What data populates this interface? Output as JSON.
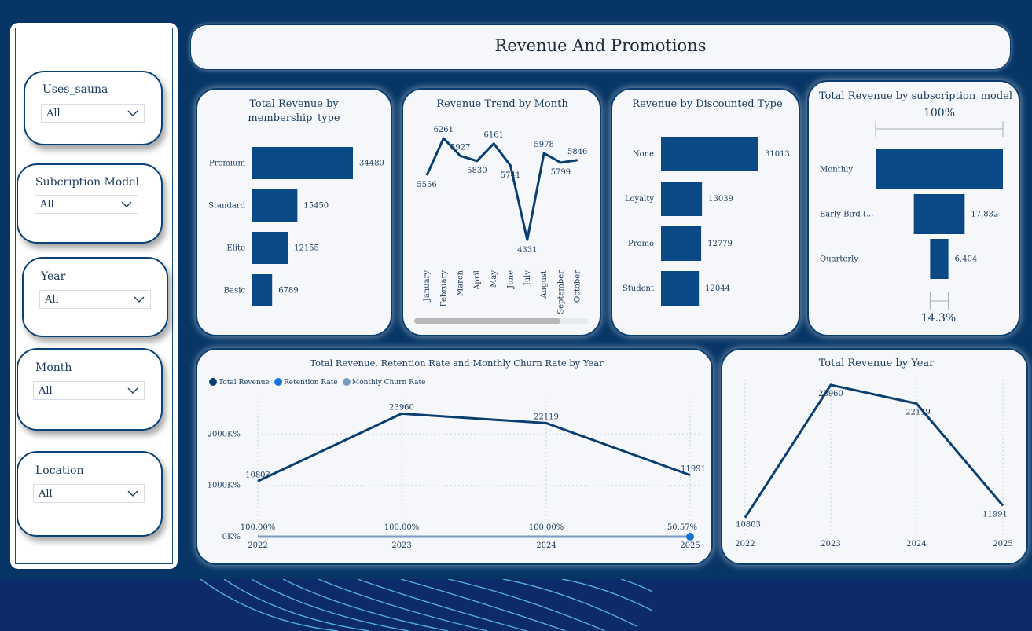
{
  "page": {
    "title": "Revenue And Promotions",
    "colors": {
      "background": "#063566",
      "bar": "#0b4886",
      "line": "#0b3e70",
      "accent": "#1573d6",
      "churn": "#7b9cc0"
    }
  },
  "filters": [
    {
      "title": "Uses_sauna",
      "value": "All"
    },
    {
      "title": "Subcription Model",
      "value": "All"
    },
    {
      "title": "Year",
      "value": "All"
    },
    {
      "title": "Month",
      "value": "All"
    },
    {
      "title": "Location",
      "value": "All"
    }
  ],
  "chart_data": [
    {
      "type": "bar",
      "orientation": "horizontal",
      "title": "Total Revenue by membership_type",
      "title_lines": [
        "Total Revenue by",
        "membership_type"
      ],
      "categories": [
        "Premium",
        "Standard",
        "Elite",
        "Basic"
      ],
      "values": [
        34480,
        15450,
        12155,
        6789
      ],
      "data_labels": [
        "34480",
        "15450",
        "12155",
        "6789"
      ]
    },
    {
      "type": "line",
      "title": "Revenue Trend by Month",
      "categories": [
        "January",
        "February",
        "March",
        "April",
        "May",
        "June",
        "July",
        "August",
        "September",
        "October"
      ],
      "values": [
        5556,
        6261,
        5927,
        5830,
        6161,
        5741,
        4331,
        5978,
        5799,
        5846
      ],
      "data_labels": [
        "5556",
        "6261",
        "5927",
        "5830",
        "6161",
        "5741",
        "4331",
        "5978",
        "5799",
        "5846"
      ],
      "ylim": [
        4200,
        6350
      ]
    },
    {
      "type": "bar",
      "orientation": "horizontal",
      "title": "Revenue by Discounted Type",
      "categories": [
        "None",
        "Loyalty",
        "Promo",
        "Student"
      ],
      "values": [
        31013,
        13039,
        12779,
        12044
      ],
      "data_labels": [
        "31013",
        "13039",
        "12779",
        "12044"
      ]
    },
    {
      "type": "bar",
      "subtype": "funnel",
      "title": "Total Revenue by subscription_model",
      "categories": [
        "Monthly",
        "Early Bird (...",
        "Quarterly"
      ],
      "values": [
        44639,
        17832,
        6404
      ],
      "data_labels": [
        "",
        "17,832",
        "6,404"
      ],
      "top_percent": "100%",
      "bottom_percent": "14.3%"
    },
    {
      "type": "line",
      "title": "Total Revenue, Retention Rate and Monthly Churn Rate by Year",
      "legend": [
        "Total Revenue",
        "Retention Rate",
        "Monthly Churn Rate"
      ],
      "legend_placement": "top-left",
      "x": [
        "2022",
        "2023",
        "2024",
        "2025"
      ],
      "series": [
        {
          "name": "Total Revenue",
          "values": [
            10803,
            23960,
            22119,
            11991
          ],
          "labels": [
            "10803",
            "23960",
            "22119",
            "11991"
          ]
        },
        {
          "name": "Retention Rate",
          "values": [
            100,
            100,
            100,
            50.57
          ],
          "labels": [
            "100.00%",
            "100.00%",
            "100.00%",
            "50.57%"
          ]
        },
        {
          "name": "Monthly Churn Rate",
          "values": [
            0,
            0,
            0,
            0
          ]
        }
      ],
      "yticks": [
        "0K%",
        "1000K%",
        "2000K%"
      ],
      "ylim": [
        0,
        28000
      ],
      "grid": true
    },
    {
      "type": "line",
      "title": "Total Revenue by Year",
      "x": [
        "2022",
        "2023",
        "2024",
        "2025"
      ],
      "values": [
        10803,
        23960,
        22119,
        11991
      ],
      "data_labels": [
        "10803",
        "23960",
        "22119",
        "11991"
      ],
      "ylim": [
        10000,
        24500
      ],
      "grid": true
    }
  ]
}
